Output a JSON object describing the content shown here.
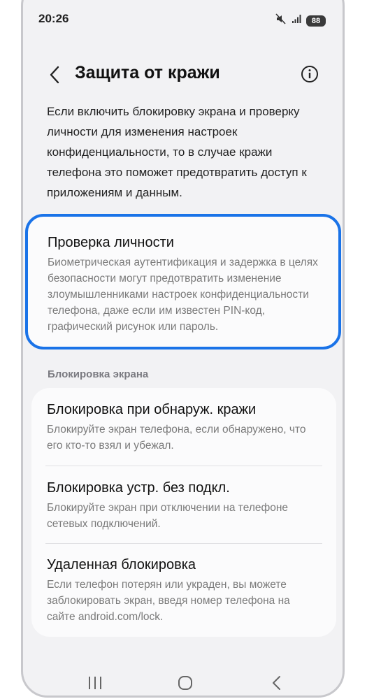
{
  "status_bar": {
    "time": "20:26",
    "battery": "88",
    "icons": [
      "mute-icon",
      "signal-icon",
      "battery-icon"
    ]
  },
  "header": {
    "title": "Защита от кражи",
    "back_icon": "chevron-left-icon",
    "info_icon": "info-icon"
  },
  "intro_text": "Если включить блокировку экрана и проверку личности для изменения настроек конфиденциальности, то в случае кражи телефона это поможет предотвратить доступ к приложениям и данным.",
  "identity_check": {
    "title": "Проверка личности",
    "description": "Биометрическая аутентификация и задержка в целях безопасности могут предотвратить изменение злоумышленниками настроек конфиденциальности телефона, даже если им известен PIN-код, графический рисунок или пароль."
  },
  "screen_lock_section": {
    "label": "Блокировка экрана",
    "items": [
      {
        "title": "Блокировка при обнаруж. кражи",
        "description": "Блокируйте экран телефона, если обнаружено, что его кто-то взял и убежал."
      },
      {
        "title": "Блокировка устр. без подкл.",
        "description": "Блокируйте экран при отключении на телефоне сетевых подключений."
      },
      {
        "title": "Удаленная блокировка",
        "description": "Если телефон потерян или украден, вы можете заблокировать экран, введя номер телефона на сайте android.com/lock."
      }
    ]
  },
  "nav_bar": {
    "icons": [
      "recent-apps-icon",
      "home-icon",
      "back-icon"
    ]
  },
  "colors": {
    "accent": "#1a73e8",
    "background": "#f2f2f4",
    "card": "#fbfbfc"
  }
}
